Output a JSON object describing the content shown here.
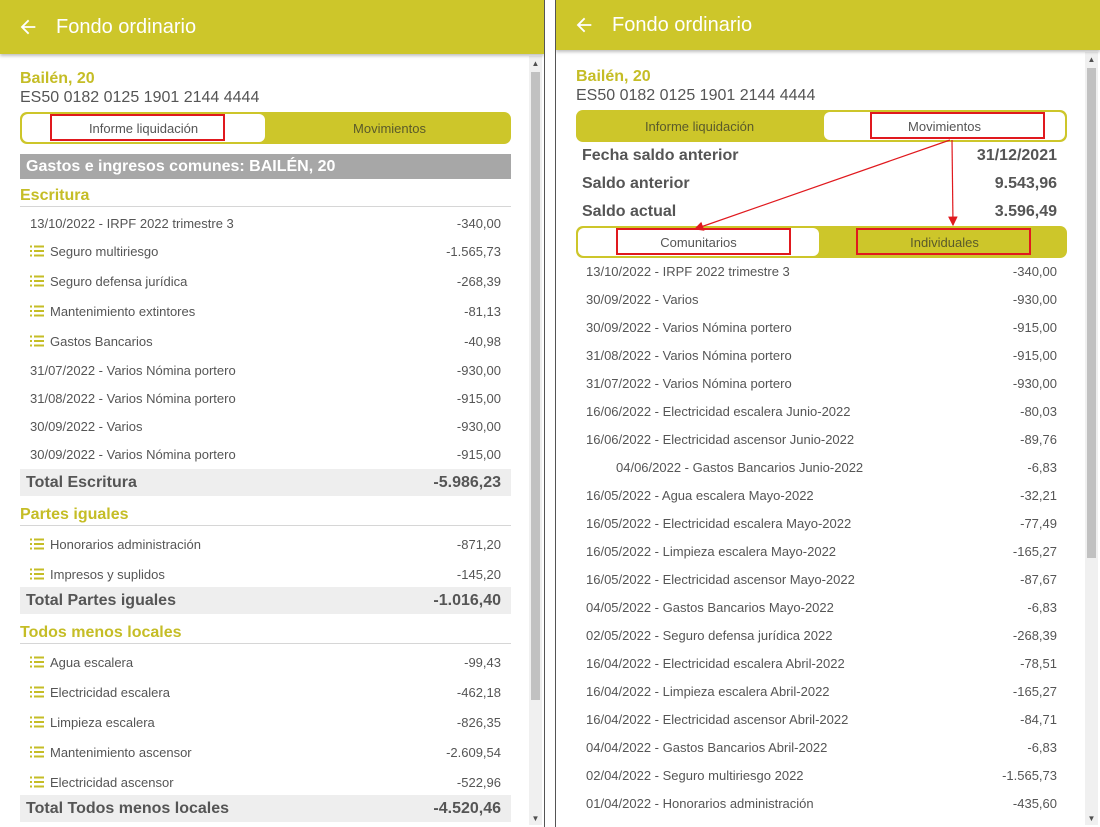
{
  "left": {
    "title": "Fondo ordinario",
    "community": "Bailén, 20",
    "iban": "ES50 0182 0125 1901 2144 4444",
    "tabs": [
      "Informe liquidación",
      "Movimientos"
    ],
    "section_title": "Gastos e ingresos comunes: BAILÉN, 20",
    "groups": [
      {
        "name": "Escritura",
        "rows": [
          {
            "label": "13/10/2022 - IRPF 2022 trimestre 3",
            "value": "-340,00",
            "icon": false
          },
          {
            "label": "Seguro multiriesgo",
            "value": "-1.565,73",
            "icon": true
          },
          {
            "label": "Seguro defensa jurídica",
            "value": "-268,39",
            "icon": true
          },
          {
            "label": "Mantenimiento extintores",
            "value": "-81,13",
            "icon": true
          },
          {
            "label": "Gastos Bancarios",
            "value": "-40,98",
            "icon": true
          },
          {
            "label": "31/07/2022 - Varios Nómina portero",
            "value": "-930,00",
            "icon": false
          },
          {
            "label": "31/08/2022 - Varios Nómina portero",
            "value": "-915,00",
            "icon": false
          },
          {
            "label": "30/09/2022 - Varios",
            "value": "-930,00",
            "icon": false
          },
          {
            "label": "30/09/2022 - Varios Nómina portero",
            "value": "-915,00",
            "icon": false
          }
        ],
        "total_label": "Total Escritura",
        "total_value": "-5.986,23"
      },
      {
        "name": "Partes iguales",
        "rows": [
          {
            "label": "Honorarios administración",
            "value": "-871,20",
            "icon": true
          },
          {
            "label": "Impresos y suplidos",
            "value": "-145,20",
            "icon": true
          }
        ],
        "total_label": "Total Partes iguales",
        "total_value": "-1.016,40"
      },
      {
        "name": "Todos menos locales",
        "rows": [
          {
            "label": "Agua escalera",
            "value": "-99,43",
            "icon": true
          },
          {
            "label": "Electricidad escalera",
            "value": "-462,18",
            "icon": true
          },
          {
            "label": "Limpieza escalera",
            "value": "-826,35",
            "icon": true
          },
          {
            "label": "Mantenimiento ascensor",
            "value": "-2.609,54",
            "icon": true
          },
          {
            "label": "Electricidad ascensor",
            "value": "-522,96",
            "icon": true
          }
        ],
        "total_label": "Total Todos menos locales",
        "total_value": "-4.520,46"
      }
    ]
  },
  "right": {
    "title": "Fondo ordinario",
    "community": "Bailén, 20",
    "iban": "ES50 0182 0125 1901 2144 4444",
    "tabs": [
      "Informe liquidación",
      "Movimientos"
    ],
    "summary": [
      {
        "label": "Fecha saldo anterior",
        "value": "31/12/2021"
      },
      {
        "label": "Saldo anterior",
        "value": "9.543,96"
      },
      {
        "label": "Saldo actual",
        "value": "3.596,49"
      }
    ],
    "subtabs": [
      "Comunitarios",
      "Individuales"
    ],
    "movements": [
      {
        "label": "13/10/2022 - IRPF 2022 trimestre 3",
        "value": "-340,00",
        "indent": false
      },
      {
        "label": "30/09/2022 - Varios",
        "value": "-930,00",
        "indent": false
      },
      {
        "label": "30/09/2022 - Varios Nómina portero",
        "value": "-915,00",
        "indent": false
      },
      {
        "label": "31/08/2022 - Varios Nómina portero",
        "value": "-915,00",
        "indent": false
      },
      {
        "label": "31/07/2022 - Varios Nómina portero",
        "value": "-930,00",
        "indent": false
      },
      {
        "label": "16/06/2022 - Electricidad escalera Junio-2022",
        "value": "-80,03",
        "indent": false
      },
      {
        "label": "16/06/2022 - Electricidad ascensor Junio-2022",
        "value": "-89,76",
        "indent": false
      },
      {
        "label": "04/06/2022 - Gastos Bancarios Junio-2022",
        "value": "-6,83",
        "indent": true
      },
      {
        "label": "16/05/2022 - Agua escalera Mayo-2022",
        "value": "-32,21",
        "indent": false
      },
      {
        "label": "16/05/2022 - Electricidad escalera Mayo-2022",
        "value": "-77,49",
        "indent": false
      },
      {
        "label": "16/05/2022 - Limpieza escalera Mayo-2022",
        "value": "-165,27",
        "indent": false
      },
      {
        "label": "16/05/2022 - Electricidad ascensor Mayo-2022",
        "value": "-87,67",
        "indent": false
      },
      {
        "label": "04/05/2022 - Gastos Bancarios Mayo-2022",
        "value": "-6,83",
        "indent": false
      },
      {
        "label": "02/05/2022 - Seguro defensa jurídica 2022",
        "value": "-268,39",
        "indent": false
      },
      {
        "label": "16/04/2022 - Electricidad escalera Abril-2022",
        "value": "-78,51",
        "indent": false
      },
      {
        "label": "16/04/2022 - Limpieza escalera Abril-2022",
        "value": "-165,27",
        "indent": false
      },
      {
        "label": "16/04/2022 - Electricidad ascensor Abril-2022",
        "value": "-84,71",
        "indent": false
      },
      {
        "label": "04/04/2022 - Gastos Bancarios Abril-2022",
        "value": "-6,83",
        "indent": false
      },
      {
        "label": "02/04/2022 - Seguro multiriesgo 2022",
        "value": "-1.565,73",
        "indent": false
      },
      {
        "label": "01/04/2022 - Honorarios administración",
        "value": "-435,60",
        "indent": false
      }
    ]
  },
  "colors": {
    "accent": "#cdc62a",
    "accent_text": "#c5bd26",
    "highlight": "#e0191e",
    "banner": "#a7a7a7",
    "total_bg": "#eeeeee"
  }
}
